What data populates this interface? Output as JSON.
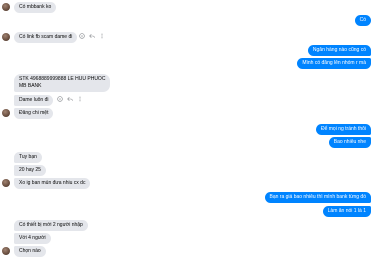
{
  "messages": [
    {
      "dir": "in",
      "text": "Có mbbank ko"
    },
    {
      "dir": "out",
      "text": "Có"
    },
    {
      "dir": "in",
      "text": "Có link fb scam dame đi"
    },
    {
      "dir": "out",
      "text": "Ngân hàng nào cũng có"
    },
    {
      "dir": "out",
      "text": "Mình có đăng lên nhóm r mà"
    },
    {
      "dir": "in",
      "lines": [
        "STK 4968889999888 LE HUU PHUOC",
        "MB BANK"
      ]
    },
    {
      "dir": "in",
      "text": "Dame luôn đi"
    },
    {
      "dir": "in",
      "text": "Đăng chi mệt"
    },
    {
      "dir": "out",
      "text": "Để mọi ng tránh thôi"
    },
    {
      "dir": "out",
      "text": "Bao nhiêu nhe"
    },
    {
      "dir": "in",
      "text": "Tuy bạn"
    },
    {
      "dir": "in",
      "text": "20 hay 25"
    },
    {
      "dir": "in",
      "text": "Xo ig ban mún đưa nhiu cx dc"
    },
    {
      "dir": "out",
      "text": "Bạn ra giá bao nhiêu thì mình bank từng đó"
    },
    {
      "dir": "out",
      "text": "Làm ăn nói 1 là 1"
    },
    {
      "dir": "in",
      "text": "Có thiết bị mới 2 người nhập"
    },
    {
      "dir": "in",
      "text": "Với 4 người"
    },
    {
      "dir": "in",
      "text": "Chọn nào"
    }
  ],
  "action_icons": [
    "emoji-reaction-icon",
    "reply-icon",
    "more-options-icon"
  ],
  "colors": {
    "incoming": "#e4e6eb",
    "outgoing": "#0084ff"
  }
}
